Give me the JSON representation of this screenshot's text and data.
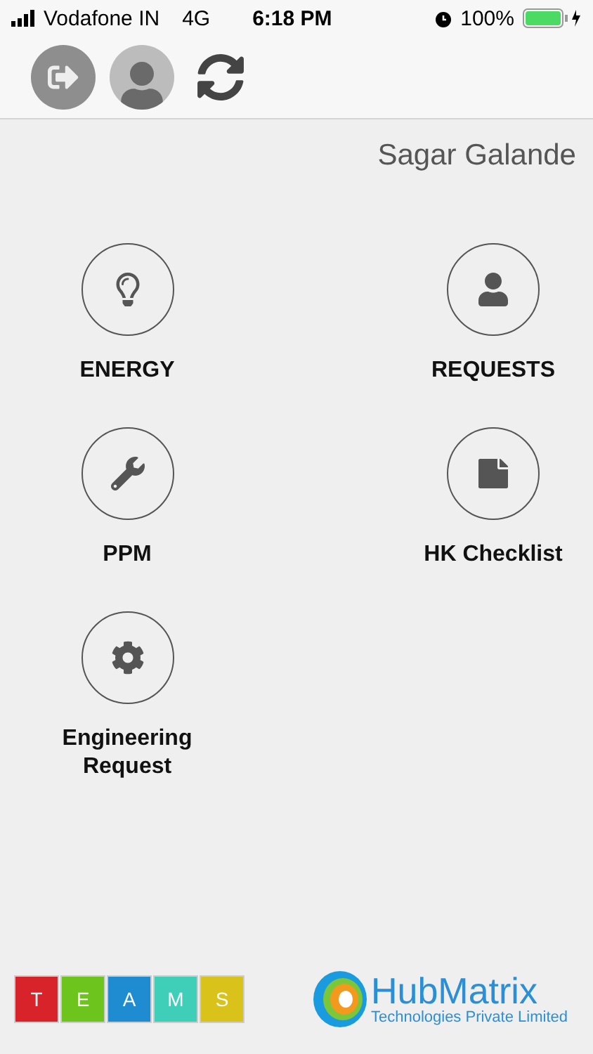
{
  "status_bar": {
    "carrier": "Vodafone IN",
    "network": "4G",
    "time": "6:18 PM",
    "battery": "100%"
  },
  "toolbar": {
    "buttons": [
      {
        "kind": "logout"
      },
      {
        "kind": "profile"
      },
      {
        "kind": "refresh"
      }
    ]
  },
  "user_name": "Sagar Galande",
  "tiles": [
    {
      "label": "ENERGY",
      "kind": "bulb"
    },
    {
      "label": "REQUESTS",
      "kind": "person"
    },
    {
      "label": "PPM",
      "kind": "wrench"
    },
    {
      "label": "HK Checklist",
      "kind": "note"
    },
    {
      "label": "Engineering Request",
      "kind": "gear"
    }
  ],
  "footer": {
    "teams_letters": [
      {
        "letter": "T",
        "color": "#d8232a"
      },
      {
        "letter": "E",
        "color": "#6cc41d"
      },
      {
        "letter": "A",
        "color": "#1f8bd0"
      },
      {
        "letter": "M",
        "color": "#3fcfb8"
      },
      {
        "letter": "S",
        "color": "#d9c21a"
      }
    ],
    "company": "HubMatrix",
    "tagline": "Technologies Private Limited"
  }
}
